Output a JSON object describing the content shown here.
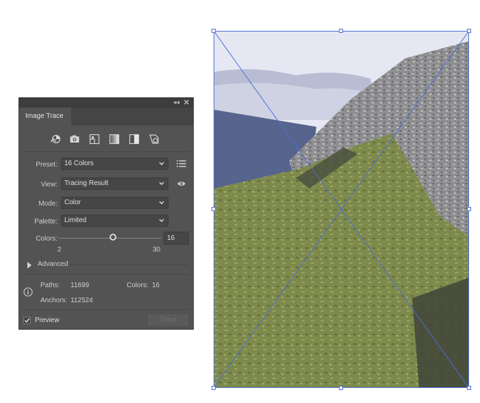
{
  "panel": {
    "title": "Image Trace",
    "collapse_icon": "double-chevron-left",
    "close_icon": "close-x",
    "preset_icons": [
      "auto-color-icon",
      "high-color-photo-icon",
      "low-color-icon",
      "grayscale-icon",
      "black-and-white-icon",
      "outline-icon"
    ],
    "preset": {
      "label": "Preset:",
      "value": "16 Colors"
    },
    "view": {
      "label": "View:",
      "value": "Tracing Result"
    },
    "mode": {
      "label": "Mode:",
      "value": "Color"
    },
    "palette": {
      "label": "Palette:",
      "value": "Limited"
    },
    "colors": {
      "label": "Colors:",
      "value": "16",
      "min": "2",
      "max": "30",
      "slider_fraction": 0.5
    },
    "advanced": "Advanced",
    "stats": {
      "paths_label": "Paths:",
      "paths_value": "11699",
      "colors_label": "Colors:",
      "colors_value": "16",
      "anchors_label": "Anchors:",
      "anchors_value": "112524"
    },
    "preview": {
      "label": "Preview",
      "checked": true
    },
    "trace_button": "Trace"
  },
  "colors": {
    "panel_bg": "#535353",
    "selection_blue": "#4a6fd6"
  }
}
